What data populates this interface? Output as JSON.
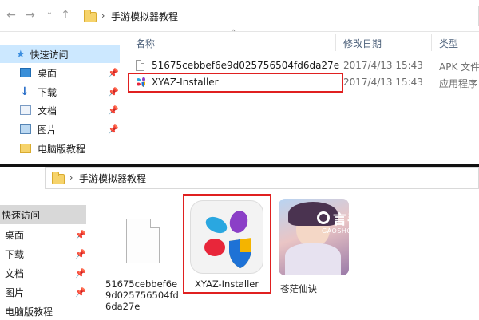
{
  "top": {
    "breadcrumb": {
      "folder": "手游模拟器教程"
    },
    "columns": {
      "name": "名称",
      "modified": "修改日期",
      "type": "类型"
    },
    "nav": [
      {
        "label": "快速访问"
      },
      {
        "label": "桌面"
      },
      {
        "label": "下载"
      },
      {
        "label": "文档"
      },
      {
        "label": "图片"
      },
      {
        "label": "电脑版教程"
      }
    ],
    "files": [
      {
        "name": "51675cebbef6e9d025756504fd6da27e",
        "date": "2017/4/13 15:43",
        "type": "APK 文件"
      },
      {
        "name": "XYAZ-Installer",
        "date": "2017/4/13 15:43",
        "type": "应用程序"
      }
    ]
  },
  "bottom": {
    "breadcrumb": {
      "folder": "手游模拟器教程"
    },
    "nav": [
      {
        "label": "快速访问"
      },
      {
        "label": "桌面"
      },
      {
        "label": "下载"
      },
      {
        "label": "文档"
      },
      {
        "label": "图片"
      },
      {
        "label": "电脑版教程"
      }
    ],
    "items": [
      {
        "label_line1": "51675cebbef6e",
        "label_line2": "9d025756504fd",
        "label_line3": "6da27e"
      },
      {
        "label": "XYAZ-Installer"
      },
      {
        "label": "苍茫仙诀"
      }
    ],
    "watermark": {
      "brand": "言手游",
      "site": "GAOSHOUYOU.COM"
    }
  }
}
